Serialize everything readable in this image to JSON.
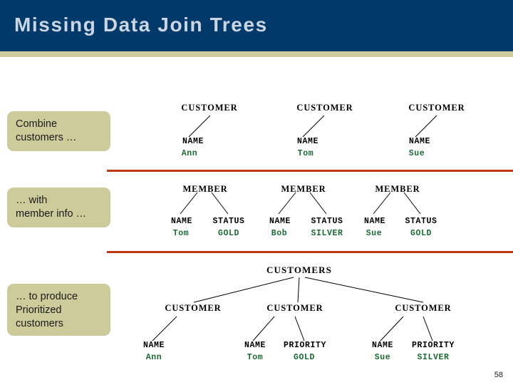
{
  "slide": {
    "title": "Missing Data Join Trees",
    "page_number": "58",
    "colors": {
      "header_bg": "#003a6b",
      "header_accent": "#cdcb9a",
      "title_text": "#ccd6e2",
      "callout_bg": "#cdcb9a",
      "divider": "#c0380f",
      "value_text": "#1a6b33",
      "node_text": "#000000"
    }
  },
  "callouts": [
    {
      "id": "combine-customers",
      "lines": [
        "Combine",
        "customers …"
      ]
    },
    {
      "id": "with-member-info",
      "lines": [
        "… with",
        "member info …"
      ]
    },
    {
      "id": "to-produce-prioritized",
      "lines": [
        "… to produce",
        "Prioritized",
        "customers"
      ]
    }
  ],
  "sections": {
    "customers_row": {
      "trees": [
        {
          "root": "CUSTOMER",
          "children": [
            {
              "label": "NAME",
              "value": "Ann"
            }
          ]
        },
        {
          "root": "CUSTOMER",
          "children": [
            {
              "label": "NAME",
              "value": "Tom"
            }
          ]
        },
        {
          "root": "CUSTOMER",
          "children": [
            {
              "label": "NAME",
              "value": "Sue"
            }
          ]
        }
      ]
    },
    "members_row": {
      "trees": [
        {
          "root": "MEMBER",
          "children": [
            {
              "label": "NAME",
              "value": "Tom"
            },
            {
              "label": "STATUS",
              "value": "GOLD"
            }
          ]
        },
        {
          "root": "MEMBER",
          "children": [
            {
              "label": "NAME",
              "value": "Bob"
            },
            {
              "label": "STATUS",
              "value": "SILVER"
            }
          ]
        },
        {
          "root": "MEMBER",
          "children": [
            {
              "label": "NAME",
              "value": "Sue"
            },
            {
              "label": "STATUS",
              "value": "GOLD"
            }
          ]
        }
      ]
    },
    "result_tree": {
      "root": "CUSTOMERS",
      "branches": [
        {
          "root": "CUSTOMER",
          "children": [
            {
              "label": "NAME",
              "value": "Ann"
            }
          ]
        },
        {
          "root": "CUSTOMER",
          "children": [
            {
              "label": "NAME",
              "value": "Tom"
            },
            {
              "label": "PRIORITY",
              "value": "GOLD"
            }
          ]
        },
        {
          "root": "CUSTOMER",
          "children": [
            {
              "label": "NAME",
              "value": "Sue"
            },
            {
              "label": "PRIORITY",
              "value": "SILVER"
            }
          ]
        }
      ]
    }
  }
}
